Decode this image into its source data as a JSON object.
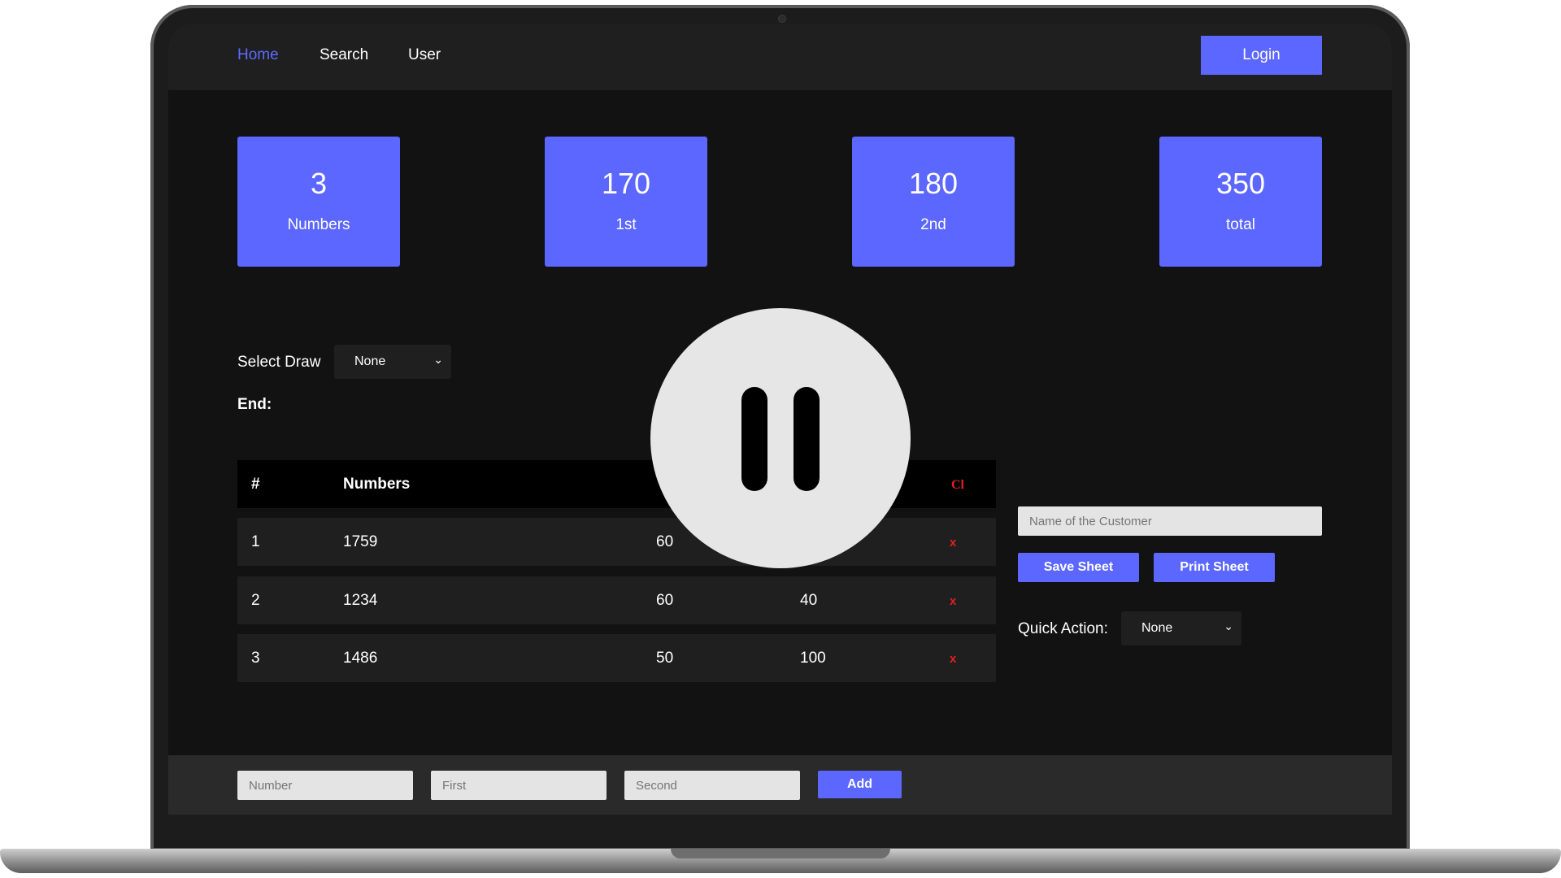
{
  "nav": {
    "home": "Home",
    "search": "Search",
    "user": "User",
    "login": "Login",
    "active_color": "#5e6bff"
  },
  "stats": [
    {
      "value": "3",
      "label": "Numbers"
    },
    {
      "value": "170",
      "label": "1st"
    },
    {
      "value": "180",
      "label": "2nd"
    },
    {
      "value": "350",
      "label": "total"
    }
  ],
  "draw": {
    "label": "Select Draw",
    "selected": "None",
    "end_label": "End:"
  },
  "table": {
    "headers": {
      "index": "#",
      "numbers": "Numbers",
      "cl": "Cl"
    },
    "rows": [
      {
        "index": "1",
        "number": "1759",
        "first": "60",
        "second": "",
        "remove": "x"
      },
      {
        "index": "2",
        "number": "1234",
        "first": "60",
        "second": "40",
        "remove": "x"
      },
      {
        "index": "3",
        "number": "1486",
        "first": "50",
        "second": "100",
        "remove": "x"
      }
    ]
  },
  "side": {
    "customer_placeholder": "Name of the Customer",
    "save_sheet": "Save Sheet",
    "print_sheet": "Print Sheet",
    "quick_action_label": "Quick Action:",
    "quick_action_selected": "None"
  },
  "footer": {
    "number_placeholder": "Number",
    "first_placeholder": "First",
    "second_placeholder": "Second",
    "add": "Add"
  },
  "colors": {
    "accent": "#5b67ff",
    "danger": "#e0201e",
    "background": "#121212"
  },
  "icons": {
    "overlay": "pause-icon",
    "dropdown": "chevron-down-icon"
  }
}
